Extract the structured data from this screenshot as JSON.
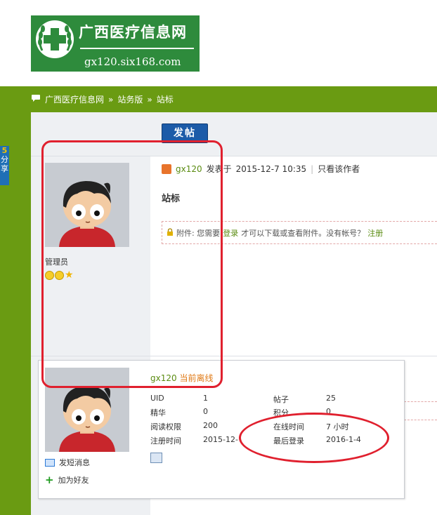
{
  "header": {
    "logo_title": "广西医疗信息网",
    "logo_url": "gx120.six168.com"
  },
  "breadcrumb": {
    "items": [
      "广西医疗信息网",
      "站务版",
      "站标"
    ],
    "separator": "»"
  },
  "side_tab": {
    "number": "5",
    "label": "分享"
  },
  "toolbar": {
    "post_button": "发帖"
  },
  "post": {
    "author": "gx120",
    "posted_prefix": "发表于",
    "posted_time": "2015-12-7 10:35",
    "only_author_link": "只看该作者",
    "title": "站标",
    "attachment_prefix": "附件: 您需要",
    "attachment_login": "登录",
    "attachment_middle": "才可以下载或查看附件。没有帐号？",
    "attachment_register": "注册"
  },
  "user": {
    "role": "管理员",
    "card_name": "gx120",
    "card_status": "当前离线",
    "stats": [
      {
        "label": "UID",
        "value": "1"
      },
      {
        "label": "帖子",
        "value": "25"
      },
      {
        "label": "精华",
        "value": "0"
      },
      {
        "label": "积分",
        "value": "0"
      },
      {
        "label": "阅读权限",
        "value": "200"
      },
      {
        "label": "在线时间",
        "value": "7 小时"
      },
      {
        "label": "注册时间",
        "value": "2015-12-"
      },
      {
        "label": "最后登录",
        "value": "2016-1-4"
      }
    ],
    "send_pm": "发短消息",
    "add_friend": "加为好友"
  },
  "colors": {
    "green_bar": "#6a9b12",
    "logo_green": "#2e8b3c",
    "annotation_red": "#e0202e",
    "link_green": "#5b8c12",
    "status_orange": "#e07a16"
  }
}
